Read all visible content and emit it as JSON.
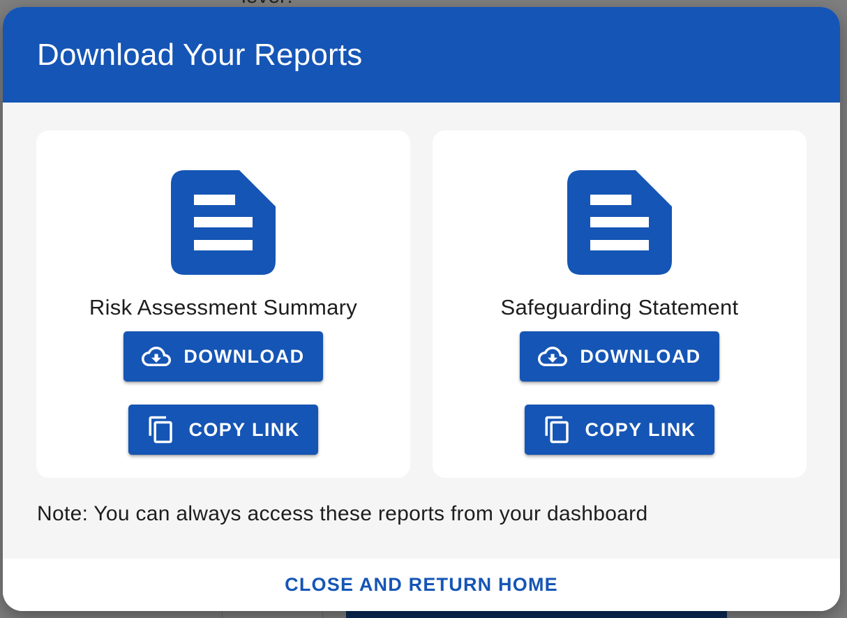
{
  "background": {
    "top_text": "level?"
  },
  "dialog": {
    "title": "Download Your Reports",
    "note": "Note: You can always access these reports from your dashboard",
    "close_label": "CLOSE AND RETURN HOME",
    "accent_color": "#1555b5"
  },
  "reports": [
    {
      "title": "Risk Assessment Summary",
      "icon": "document-icon",
      "download_label": "DOWNLOAD",
      "copy_label": "COPY LINK"
    },
    {
      "title": "Safeguarding Statement",
      "icon": "document-icon",
      "download_label": "DOWNLOAD",
      "copy_label": "COPY LINK"
    }
  ]
}
